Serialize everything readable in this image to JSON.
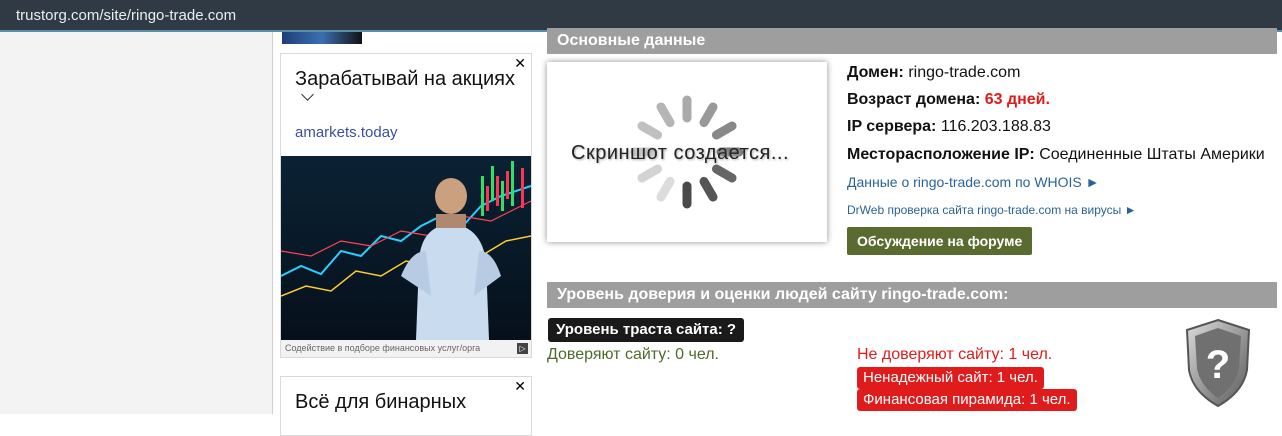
{
  "browser": {
    "url": "trustorg.com/site/ringo-trade.com"
  },
  "ads": [
    {
      "title": "Зарабатывай на акциях",
      "domain": "amarkets.today",
      "caption": "Содействие в подборе финансовых услуг/орга",
      "close": "✕"
    },
    {
      "title": "Всё для бинарных",
      "close": "✕"
    }
  ],
  "main": {
    "section1_title": "Основные данные",
    "screenshot_text": "Скриншот создается...",
    "domain_label": "Домен:",
    "domain_value": "ringo-trade.com",
    "age_label": "Возраст домена:",
    "age_value": "63 дней.",
    "ip_label": "IP сервера:",
    "ip_value": "116.203.188.83",
    "location_label": "Месторасположение IP:",
    "location_value": "Соединенные Штаты Америки",
    "whois_link": "Данные о ringo-trade.com по WHOIS ►",
    "drweb_link": "DrWeb проверка сайта ringo-trade.com на вирусы ►",
    "forum_button": "Обсуждение на форуме",
    "section2_title": "Уровень доверия и оценки людей сайту ringo-trade.com:",
    "trust_badge": "Уровень траста сайта: ?",
    "trust_yes": "Доверяют сайту: 0 чел.",
    "trust_no": "Не доверяют сайту: 1 чел.",
    "tag_unreliable": "Ненадежный сайт: 1 чел.",
    "tag_pyramid": "Финансовая пирамида: 1 чел.",
    "shield_symbol": "?"
  },
  "colors": {
    "header_bar": "#9e9e9e",
    "red": "#e01b1b",
    "forum_green": "#5a6b2f",
    "trust_green": "#4e6b2a",
    "link": "#2a6496"
  }
}
